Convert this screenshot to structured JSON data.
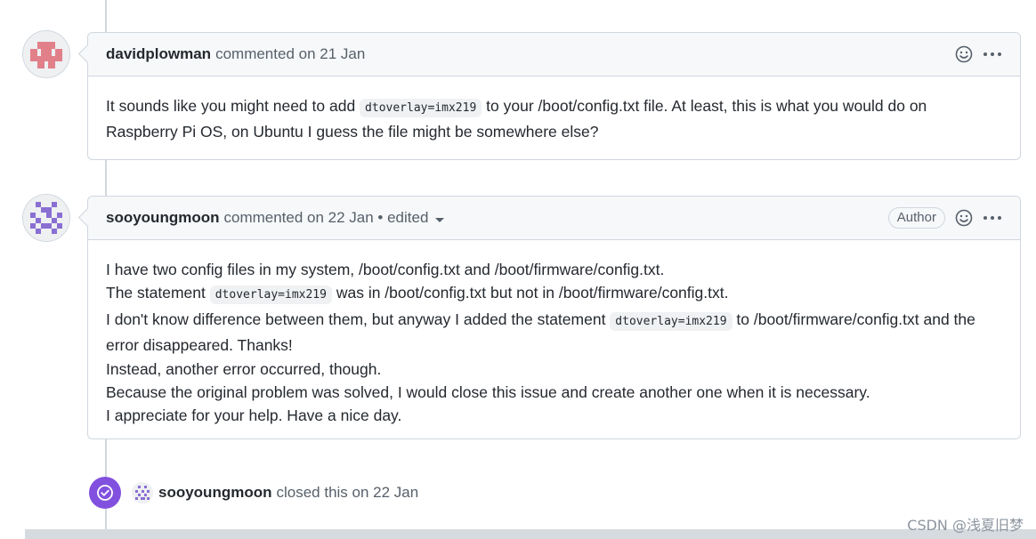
{
  "comments": [
    {
      "author": "davidplowman",
      "meta": "commented on 21 Jan",
      "body": {
        "p1_a": "It sounds like you might need to add ",
        "p1_code": "dtoverlay=imx219",
        "p1_b": " to your /boot/config.txt file. At least, this is what you would do on Raspberry Pi OS, on Ubuntu I guess the file might be somewhere else?"
      }
    },
    {
      "author": "sooyoungmoon",
      "meta": "commented on 22 Jan • edited",
      "badge": "Author",
      "body": {
        "line1": "I have two config files in my system, /boot/config.txt and /boot/firmware/config.txt.",
        "line2_a": "The statement ",
        "line2_code": "dtoverlay=imx219",
        "line2_b": " was in /boot/config.txt but not in /boot/firmware/config.txt.",
        "line3_a": "I don't know difference between them, but anyway I added the statement ",
        "line3_code": "dtoverlay=imx219",
        "line3_b": " to /boot/firmware/config.txt and the error disappeared. Thanks!",
        "line4": "Instead, another error occurred, though.",
        "line5": "Because the original problem was solved, I would close this issue and create another one when it is necessary.",
        "line6": "I appreciate for your help. Have a nice day."
      }
    }
  ],
  "event": {
    "actor": "sooyoungmoon",
    "text": "closed this on 22 Jan"
  },
  "watermark": "CSDN @浅夏旧梦",
  "icons": {
    "reaction": "smiley-icon",
    "more": "kebab-horizontal-icon",
    "closed": "issue-closed-check-icon"
  },
  "colors": {
    "closed_badge": "#8250df",
    "avatar_david": "#e2808a",
    "avatar_soo": "#8a6fd3"
  }
}
